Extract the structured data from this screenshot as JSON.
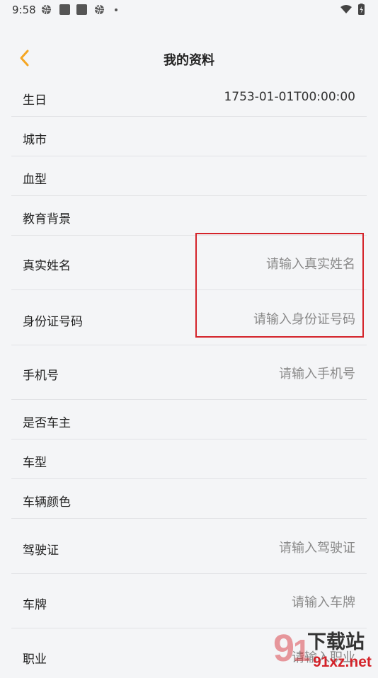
{
  "status_bar": {
    "time": "9:58"
  },
  "header": {
    "title": "我的资料"
  },
  "colors": {
    "accent": "#f5a623",
    "highlight": "#d4232a",
    "background": "#f4f5f7"
  },
  "rows": [
    {
      "label": "生日",
      "value": "1753-01-01T00:00:00"
    },
    {
      "label": "城市"
    },
    {
      "label": "血型"
    },
    {
      "label": "教育背景"
    },
    {
      "label": "真实姓名",
      "placeholder": "请输入真实姓名"
    },
    {
      "label": "身份证号码",
      "placeholder": "请输入身份证号码"
    },
    {
      "label": "手机号",
      "placeholder": "请输入手机号"
    },
    {
      "label": "是否车主"
    },
    {
      "label": "车型"
    },
    {
      "label": "车辆颜色"
    },
    {
      "label": "驾驶证",
      "placeholder": "请输入驾驶证"
    },
    {
      "label": "车牌",
      "placeholder": "请输入车牌"
    },
    {
      "label": "职业",
      "placeholder": "请输入职业"
    }
  ],
  "watermark": {
    "text": "下载站",
    "domain": "91xz.net"
  }
}
